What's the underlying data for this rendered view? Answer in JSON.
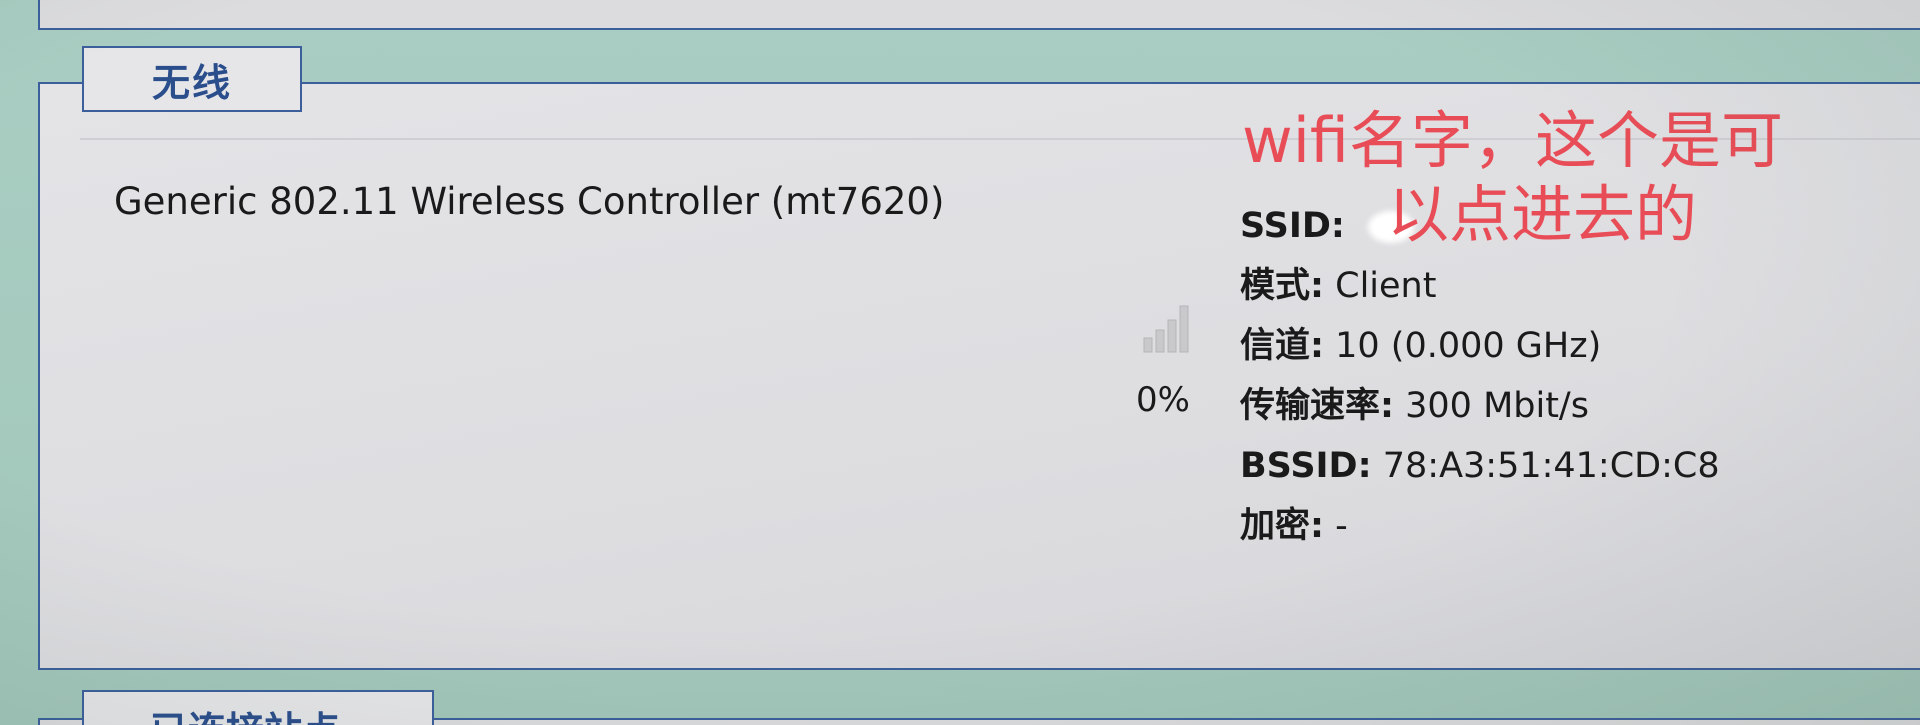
{
  "wireless_panel": {
    "legend": "无线",
    "device_name": "Generic 802.11 Wireless Controller (mt7620)",
    "signal": {
      "icon": "wifi-signal-icon",
      "percent_text": "0%",
      "percent": 0
    },
    "info": {
      "ssid_label": "SSID:",
      "ssid_value": "",
      "mode_label": "模式:",
      "mode_value": "Client",
      "channel_label": "信道:",
      "channel_value": "10 (0.000 GHz)",
      "rate_label": "传输速率:",
      "rate_value": "300 Mbit/s",
      "bssid_label": "BSSID:",
      "bssid_value": "78:A3:51:41:CD:C8",
      "encryption_label": "加密:",
      "encryption_value": "-"
    }
  },
  "annotation": {
    "line1": "wifi名字，这个是可",
    "line2": "以点进去的",
    "color": "#e84d57"
  },
  "associated_panel": {
    "legend": "已连接站点"
  },
  "colors": {
    "border": "#3c5f9c",
    "legend_text": "#2a4d8c",
    "panel_bg": "#e4e4e7",
    "page_bg": "#a6cbbf"
  }
}
